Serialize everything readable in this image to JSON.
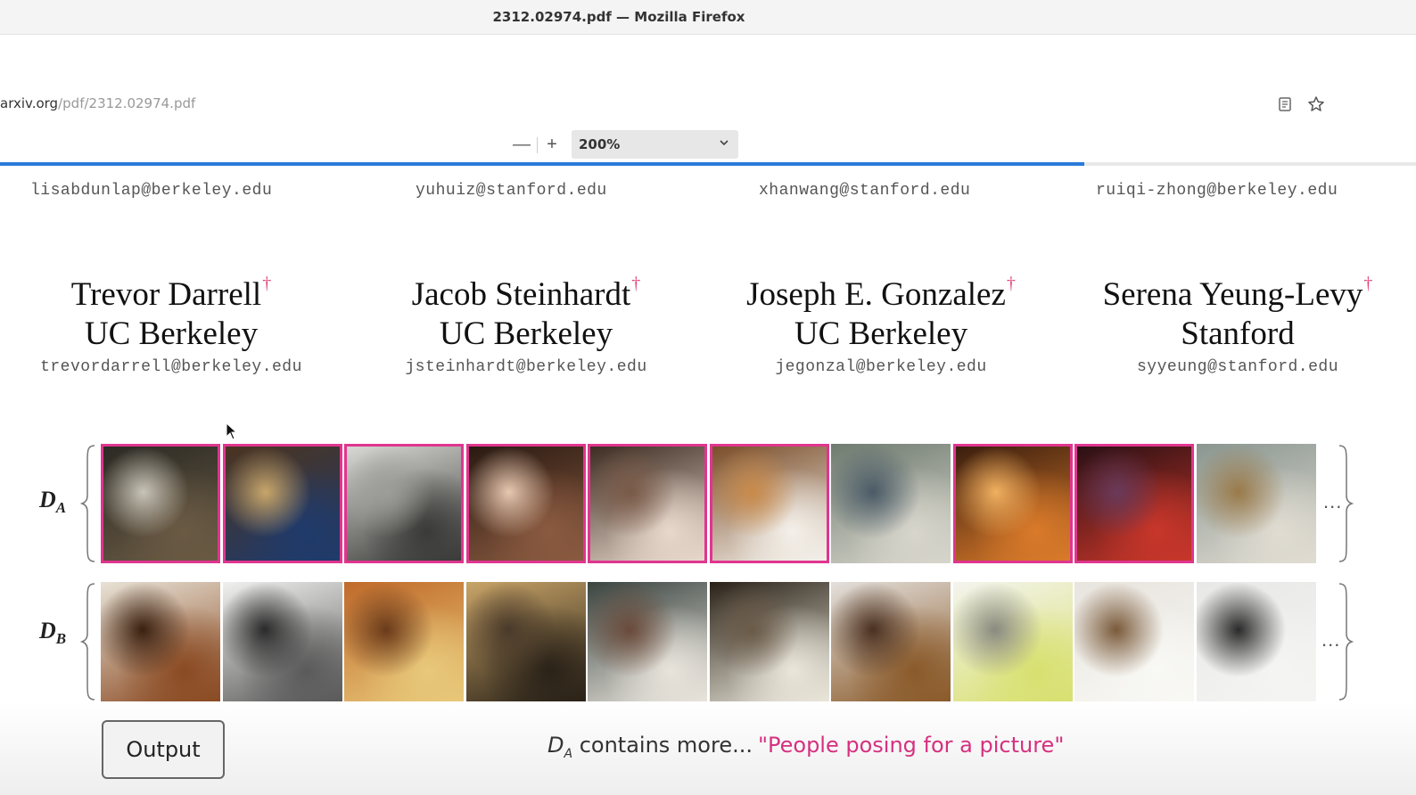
{
  "window": {
    "title": "2312.02974.pdf — Mozilla Firefox"
  },
  "urlbar": {
    "host": "arxiv.org",
    "path": "/pdf/2312.02974.pdf"
  },
  "pdf_toolbar": {
    "zoom_out": "—",
    "zoom_in": "+",
    "zoom_value": "200%",
    "page_progress_fraction": 0.766
  },
  "top_emails": [
    "lisabdunlap@berkeley.edu",
    "yuhuiz@stanford.edu",
    "xhanwang@stanford.edu",
    "ruiqi-zhong@berkeley.edu"
  ],
  "authors": [
    {
      "name": "Trevor Darrell",
      "mark": "†",
      "affiliation": "UC Berkeley",
      "email": "trevordarrell@berkeley.edu"
    },
    {
      "name": "Jacob Steinhardt",
      "mark": "†",
      "affiliation": "UC Berkeley",
      "email": "jsteinhardt@berkeley.edu"
    },
    {
      "name": "Joseph E. Gonzalez",
      "mark": "†",
      "affiliation": "UC Berkeley",
      "email": "jegonzal@berkeley.edu"
    },
    {
      "name": "Serena Yeung-Levy",
      "mark": "†",
      "affiliation": "Stanford",
      "email": "syyeung@stanford.edu"
    }
  ],
  "figure": {
    "row_a": {
      "label": "D",
      "sub": "A",
      "images": 10,
      "selected": [
        true,
        true,
        true,
        true,
        true,
        true,
        false,
        true,
        true,
        false
      ],
      "ellipsis": "..."
    },
    "row_b": {
      "label": "D",
      "sub": "B",
      "images": 10,
      "ellipsis": "..."
    },
    "output_button": "Output",
    "caption_d": "D",
    "caption_sub": "A",
    "caption_text": " contains more...",
    "caption_quote": "\"People posing for a picture\""
  },
  "colors": {
    "highlight": "#e0358f",
    "progress": "#2a7ad8"
  }
}
